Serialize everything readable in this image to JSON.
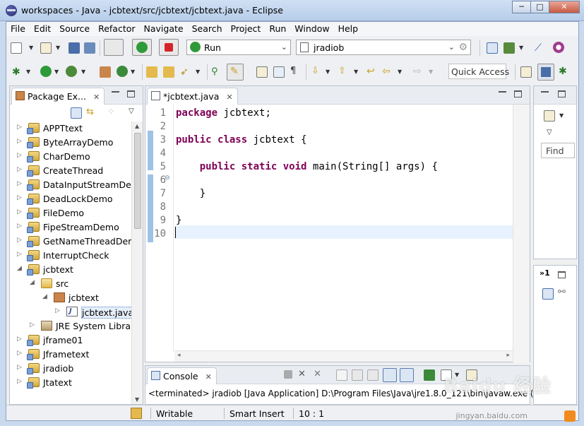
{
  "window": {
    "title": "workspaces - Java - jcbtext/src/jcbtext/jcbtext.java - Eclipse",
    "minimize": "─",
    "maximize": "□",
    "close": "✕"
  },
  "menu": [
    "File",
    "Edit",
    "Source",
    "Refactor",
    "Navigate",
    "Search",
    "Project",
    "Run",
    "Window",
    "Help"
  ],
  "toolbar": {
    "run_config": "Run",
    "launch_target": "jradiob",
    "quick_access": "Quick Access"
  },
  "package_explorer": {
    "tab_label": "Package Ex...",
    "items": [
      {
        "label": "APPTtext",
        "level": 0,
        "type": "project",
        "expanded": false
      },
      {
        "label": "ByteArrayDemo",
        "level": 0,
        "type": "project",
        "expanded": false
      },
      {
        "label": "CharDemo",
        "level": 0,
        "type": "project",
        "expanded": false
      },
      {
        "label": "CreateThread",
        "level": 0,
        "type": "project",
        "expanded": false
      },
      {
        "label": "DataInputStreamDem",
        "level": 0,
        "type": "project",
        "expanded": false
      },
      {
        "label": "DeadLockDemo",
        "level": 0,
        "type": "project",
        "expanded": false
      },
      {
        "label": "FileDemo",
        "level": 0,
        "type": "project",
        "expanded": false
      },
      {
        "label": "FipeStreamDemo",
        "level": 0,
        "type": "project",
        "expanded": false
      },
      {
        "label": "GetNameThreadDem",
        "level": 0,
        "type": "project",
        "expanded": false
      },
      {
        "label": "InterruptCheck",
        "level": 0,
        "type": "project",
        "expanded": false
      },
      {
        "label": "jcbtext",
        "level": 0,
        "type": "project",
        "expanded": true
      },
      {
        "label": "src",
        "level": 1,
        "type": "srcfolder",
        "expanded": true
      },
      {
        "label": "jcbtext",
        "level": 2,
        "type": "package",
        "expanded": true
      },
      {
        "label": "jcbtext.java",
        "level": 3,
        "type": "file",
        "expanded": false,
        "selected": true
      },
      {
        "label": "JRE System Librar",
        "level": 1,
        "type": "library",
        "expanded": false
      },
      {
        "label": "jframe01",
        "level": 0,
        "type": "project",
        "expanded": false
      },
      {
        "label": "Jframetext",
        "level": 0,
        "type": "project",
        "expanded": false
      },
      {
        "label": "jradiob",
        "level": 0,
        "type": "project",
        "expanded": false
      },
      {
        "label": "Jtatext",
        "level": 0,
        "type": "project",
        "expanded": false
      }
    ]
  },
  "editor": {
    "tab_label": "*jcbtext.java",
    "lines": [
      {
        "n": "1",
        "tokens": [
          {
            "t": "package",
            "kw": true
          },
          {
            "t": " jcbtext;",
            "kw": false
          }
        ]
      },
      {
        "n": "2",
        "tokens": []
      },
      {
        "n": "3",
        "tokens": [
          {
            "t": "public",
            "kw": true
          },
          {
            "t": " ",
            "kw": false
          },
          {
            "t": "class",
            "kw": true
          },
          {
            "t": " jcbtext {",
            "kw": false
          }
        ]
      },
      {
        "n": "4",
        "tokens": []
      },
      {
        "n": "5",
        "tokens": [
          {
            "t": "    ",
            "kw": false
          },
          {
            "t": "public",
            "kw": true
          },
          {
            "t": " ",
            "kw": false
          },
          {
            "t": "static",
            "kw": true
          },
          {
            "t": " ",
            "kw": false
          },
          {
            "t": "void",
            "kw": true
          },
          {
            "t": " main(String[] args) {",
            "kw": false
          }
        ]
      },
      {
        "n": "6",
        "tokens": []
      },
      {
        "n": "7",
        "tokens": [
          {
            "t": "    }",
            "kw": false
          }
        ]
      },
      {
        "n": "8",
        "tokens": []
      },
      {
        "n": "9",
        "tokens": [
          {
            "t": "}",
            "kw": false
          }
        ]
      },
      {
        "n": "10",
        "tokens": []
      }
    ],
    "fold_marker": "⊖"
  },
  "console": {
    "tab_label": "Console",
    "text": "<terminated> jradiob [Java Application] D:\\Program Files\\Java\\jre1.8.0_121\\bin\\javaw.exe (20"
  },
  "outline": {
    "find_placeholder": "Find"
  },
  "tasks": {
    "tab_label": "»1"
  },
  "statusbar": {
    "writable": "Writable",
    "insert_mode": "Smart Insert",
    "position": "10 : 1"
  },
  "watermark": {
    "logo": "Baidu 经验",
    "url": "jingyan.baidu.com"
  },
  "colors": {
    "keyword": "#7f0055",
    "current_line": "#e8f2fe",
    "quickdiff": "#9fc2e7"
  }
}
